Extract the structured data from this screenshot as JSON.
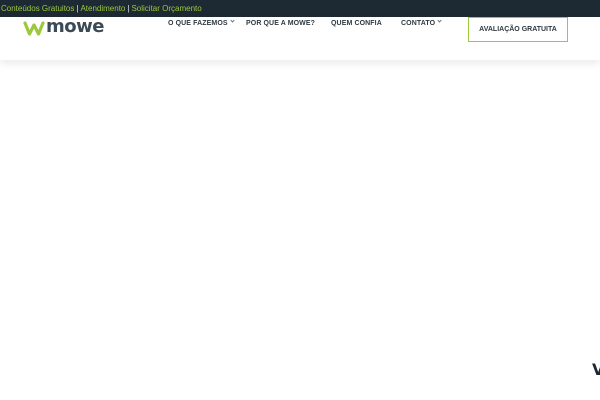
{
  "topbar": {
    "links": [
      "Conteúdos Gratuitos",
      "Atendimento",
      "Solicitar Orçamento"
    ],
    "separator": "|"
  },
  "logo": {
    "text": "mowe"
  },
  "nav": {
    "items": [
      {
        "label": "O QUE FAZEMOS"
      },
      {
        "label": "POR QUE A MOWE?"
      },
      {
        "label": "QUEM CONFIA"
      },
      {
        "label": "CONTATO"
      }
    ]
  },
  "cta": {
    "label": "AVALIAÇÃO GRATUITA"
  },
  "corner": {
    "text": "V"
  },
  "colors": {
    "topbar_bg": "#1d2a33",
    "accent_green": "#9cc93b",
    "nav_text": "#2e3940"
  }
}
